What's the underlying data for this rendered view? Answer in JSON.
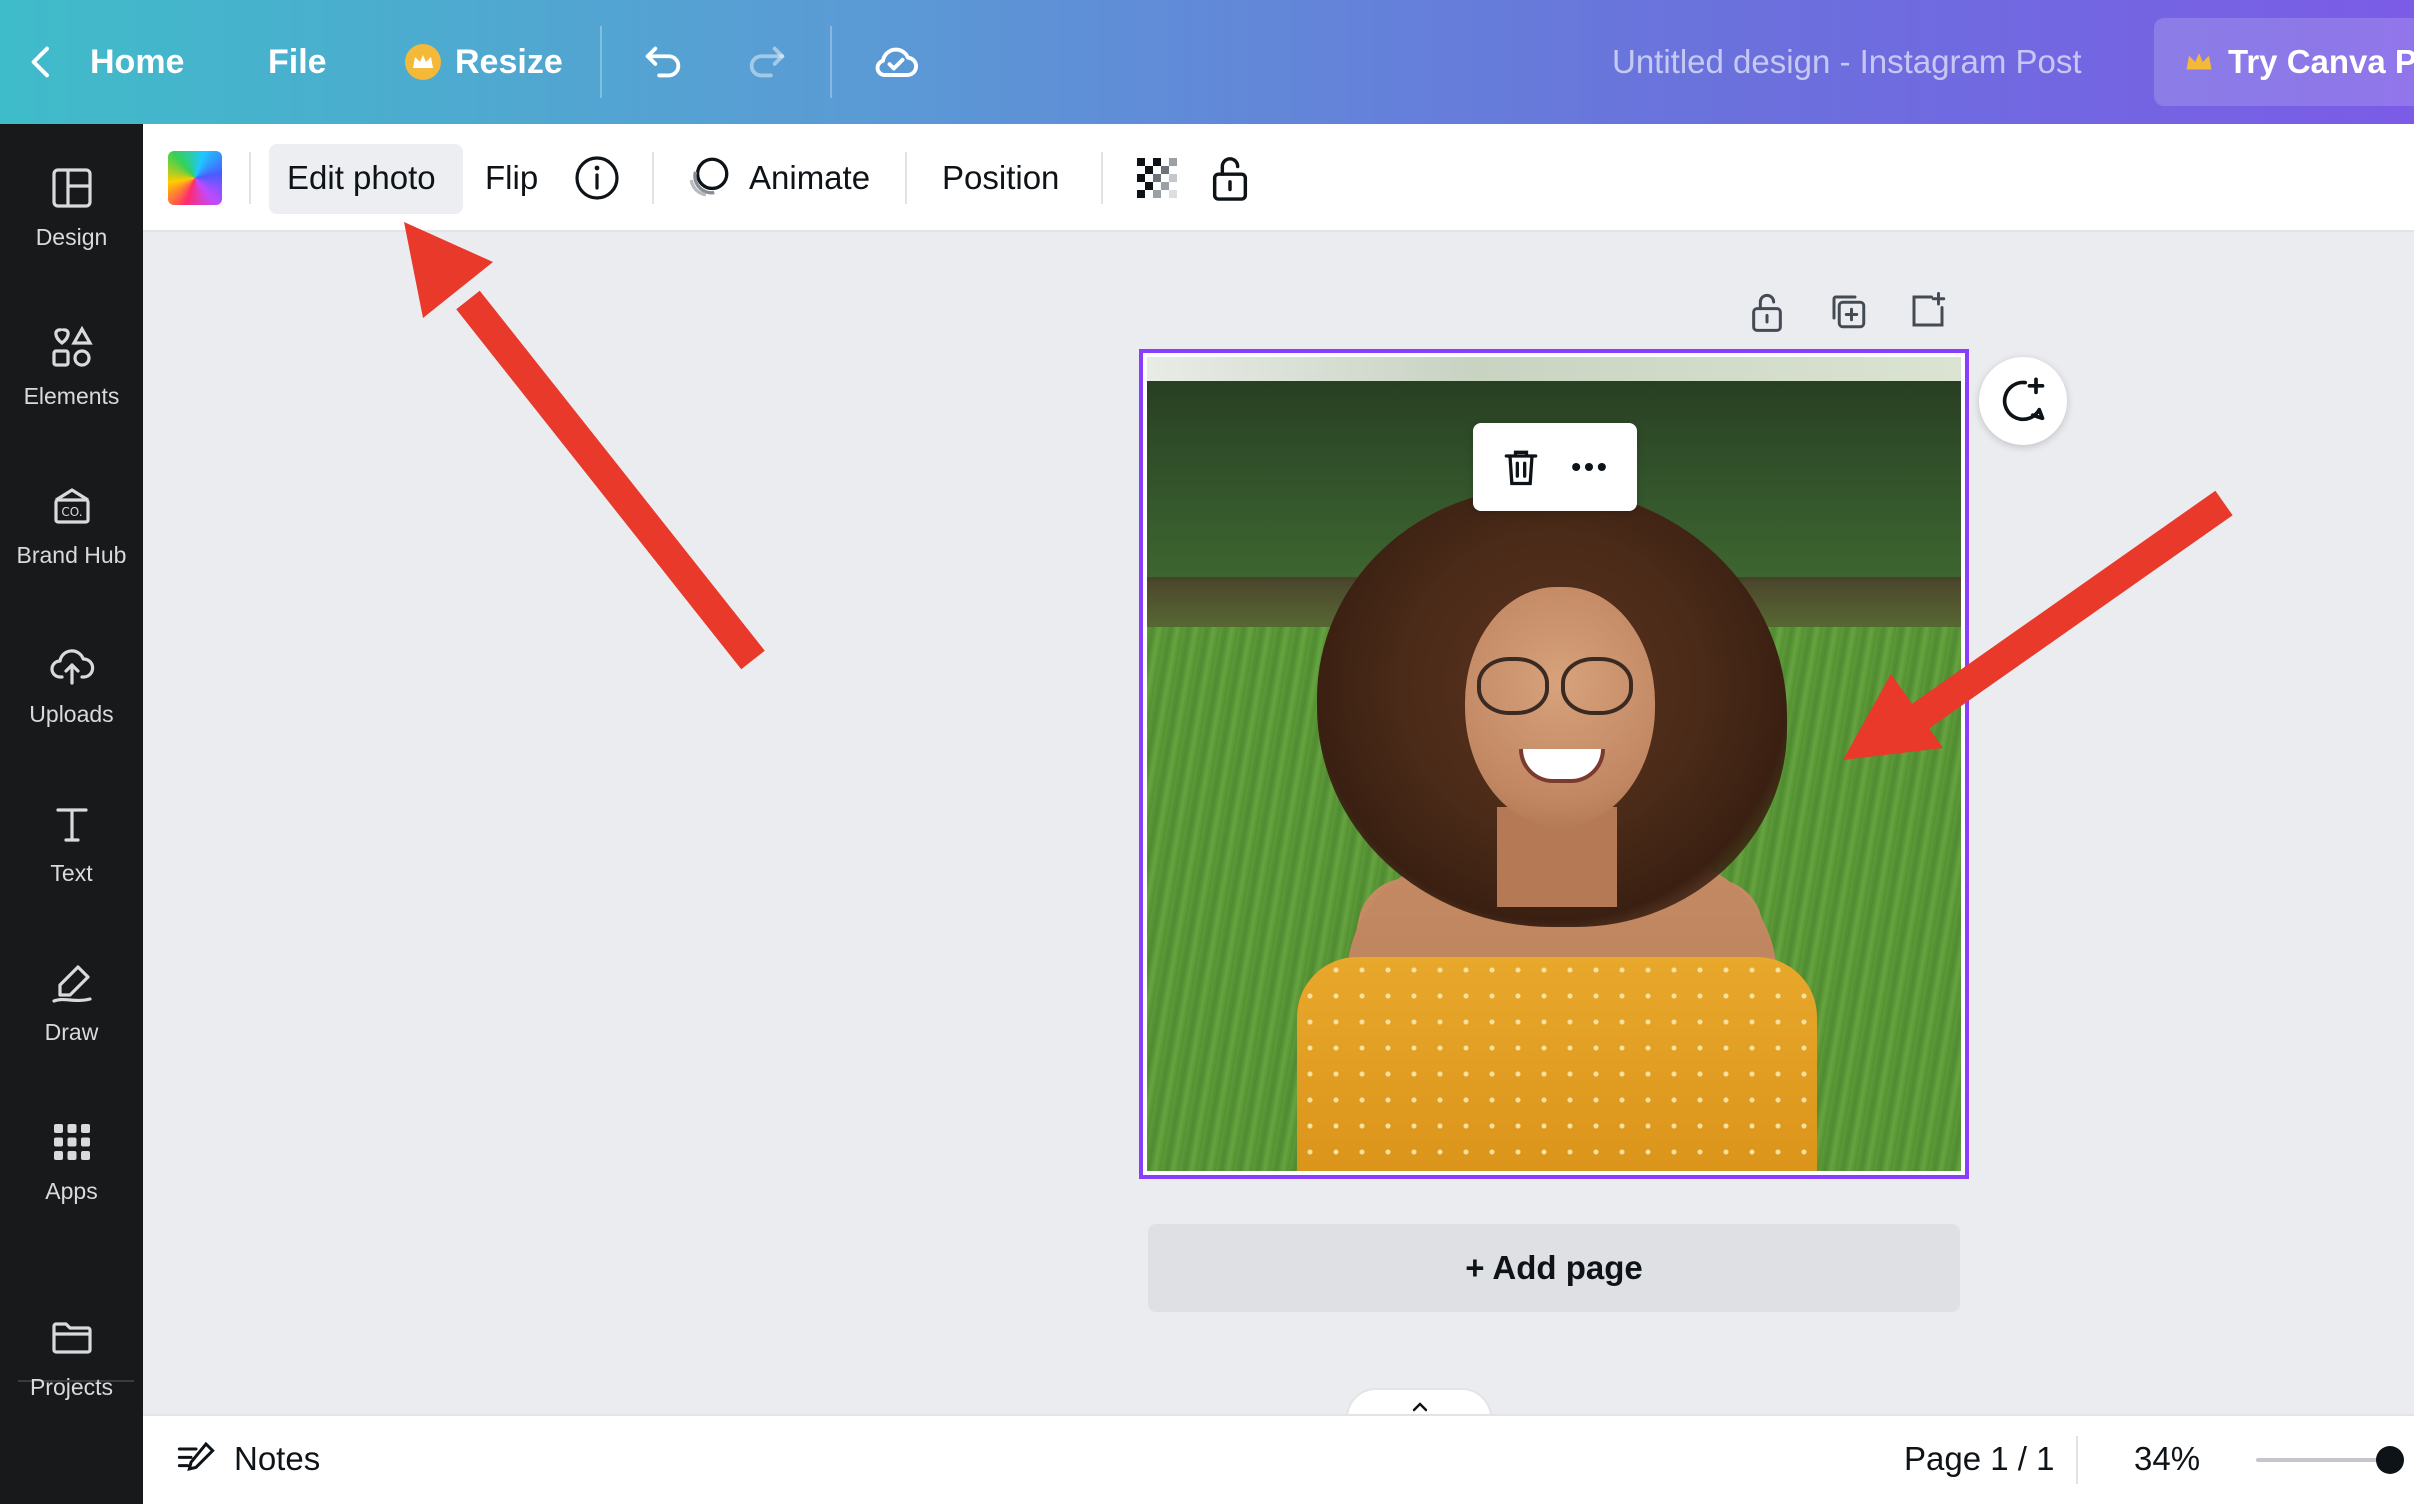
{
  "topbar": {
    "home_label": "Home",
    "file_label": "File",
    "resize_label": "Resize",
    "design_title": "Untitled design - Instagram Post",
    "try_pro_label": "Try Canva Pr"
  },
  "sidebar": {
    "items": [
      {
        "label": "Design",
        "icon": "layout-icon"
      },
      {
        "label": "Elements",
        "icon": "shapes-icon"
      },
      {
        "label": "Brand Hub",
        "icon": "brand-hub-icon"
      },
      {
        "label": "Uploads",
        "icon": "cloud-upload-icon"
      },
      {
        "label": "Text",
        "icon": "text-icon"
      },
      {
        "label": "Draw",
        "icon": "draw-icon"
      },
      {
        "label": "Apps",
        "icon": "apps-icon"
      },
      {
        "label": "Projects",
        "icon": "folder-icon"
      }
    ]
  },
  "toolbar": {
    "edit_photo_label": "Edit photo",
    "flip_label": "Flip",
    "animate_label": "Animate",
    "position_label": "Position"
  },
  "canvas": {
    "add_page_label": "+ Add page"
  },
  "bottombar": {
    "notes_label": "Notes",
    "page_indicator": "Page 1 / 1",
    "zoom_level": "34%",
    "zoom_fraction": 0.9
  },
  "colors": {
    "accent_purple": "#8b3dff",
    "arrow_red": "#e8392a",
    "sidebar_bg": "#18191b",
    "canvas_bg": "#ebecf0"
  }
}
